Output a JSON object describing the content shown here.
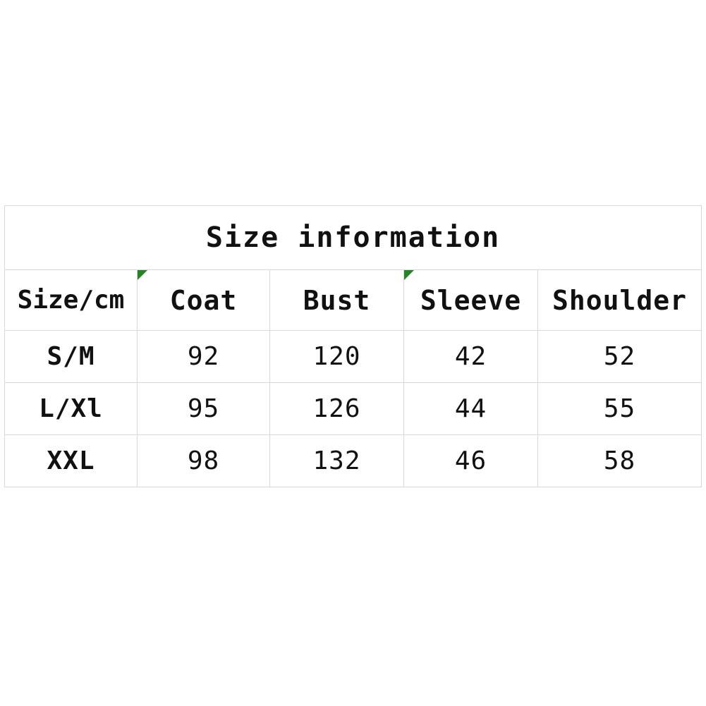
{
  "table": {
    "title": "Size information",
    "columns": [
      "Size/cm",
      "Coat",
      "Bust",
      "Sleeve",
      "Shoulder"
    ],
    "rows": [
      {
        "size": "S/M",
        "coat": "92",
        "bust": "120",
        "sleeve": "42",
        "shoulder": "52"
      },
      {
        "size": "L/Xl",
        "coat": "95",
        "bust": "126",
        "sleeve": "44",
        "shoulder": "55"
      },
      {
        "size": "XXL",
        "coat": "98",
        "bust": "132",
        "sleeve": "46",
        "shoulder": "58"
      }
    ],
    "markers": {
      "coat_corner": "green-triangle",
      "sleeve_corner": "green-triangle"
    },
    "colors": {
      "background": "#ffffff",
      "border": "#d9d9d9",
      "text": "#111111",
      "marker_green": "#1c8a1c"
    }
  },
  "chart_data": {
    "type": "table",
    "title": "Size information",
    "categories": [
      "S/M",
      "L/Xl",
      "XXL"
    ],
    "columns": [
      "Size/cm",
      "Coat",
      "Bust",
      "Sleeve",
      "Shoulder"
    ],
    "series": [
      {
        "name": "Coat",
        "values": [
          92,
          95,
          98
        ]
      },
      {
        "name": "Bust",
        "values": [
          120,
          126,
          132
        ]
      },
      {
        "name": "Sleeve",
        "values": [
          42,
          44,
          46
        ]
      },
      {
        "name": "Shoulder",
        "values": [
          52,
          55,
          58
        ]
      }
    ],
    "units": "cm",
    "xlabel": "Size/cm",
    "ylabel": ""
  }
}
